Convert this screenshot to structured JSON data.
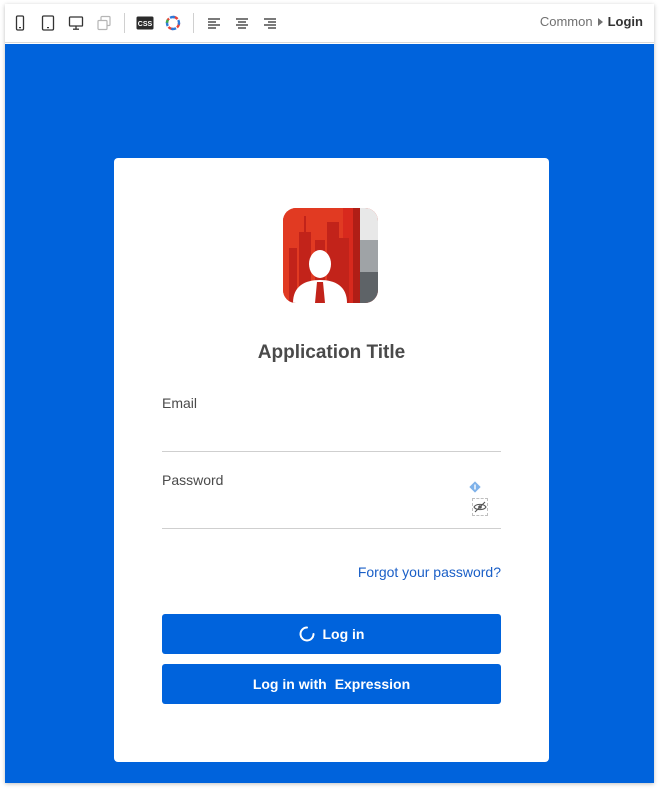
{
  "breadcrumb": {
    "parent": "Common",
    "current": "Login"
  },
  "toolbar": {
    "icons": [
      "phone-icon",
      "tablet-icon",
      "desktop-icon",
      "layers-icon",
      "css-icon",
      "color-wheel-icon",
      "align-left-icon",
      "align-center-icon",
      "align-right-icon"
    ],
    "css_label": "CSS"
  },
  "login": {
    "app_title": "Application Title",
    "email_label": "Email",
    "email_value": "",
    "password_label": "Password",
    "password_value": "",
    "forgot_link": "Forgot your password?",
    "login_button": "Log in",
    "login_expression_prefix": "Log in with",
    "login_expression_suffix": "Expression"
  },
  "colors": {
    "canvas": "#0063dc",
    "button": "#0063dc",
    "link": "#1a5fc7",
    "logo_red": "#d8291d"
  }
}
